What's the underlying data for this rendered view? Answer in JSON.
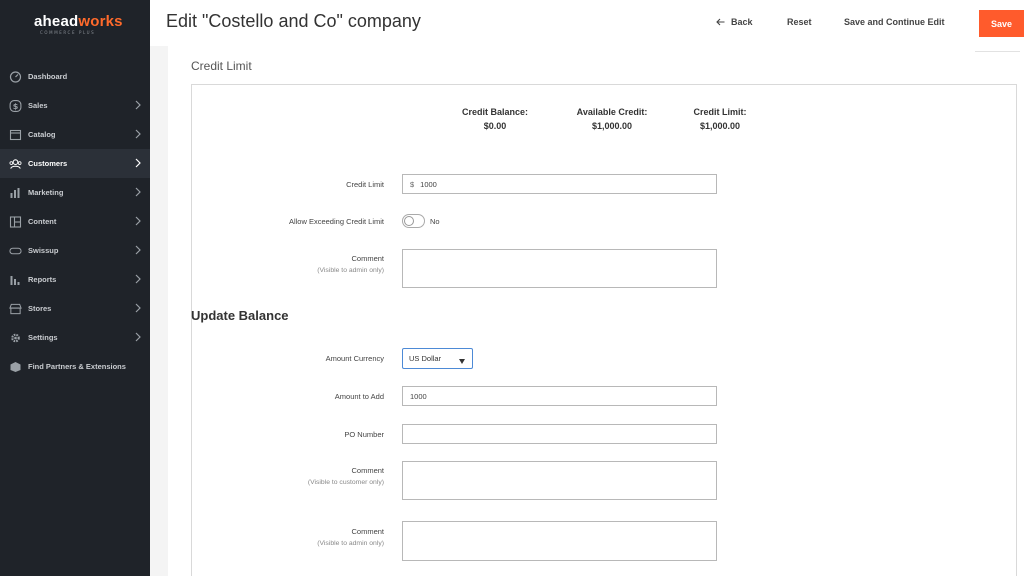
{
  "app": {
    "logo_part1": "ahead",
    "logo_part2": "works",
    "logo_tagline": "COMMERCE PLUS"
  },
  "sidebar": {
    "items": [
      {
        "label": "Dashboard",
        "icon": "dashboard-icon",
        "chevron": false
      },
      {
        "label": "Sales",
        "icon": "dollar-icon",
        "chevron": true
      },
      {
        "label": "Catalog",
        "icon": "catalog-box-icon",
        "chevron": true
      },
      {
        "label": "Customers",
        "icon": "customers-icon",
        "chevron": true,
        "active": true
      },
      {
        "label": "Marketing",
        "icon": "marketing-chart-icon",
        "chevron": true
      },
      {
        "label": "Content",
        "icon": "content-layout-icon",
        "chevron": true
      },
      {
        "label": "Swissup",
        "icon": "swissup-icon",
        "chevron": true
      },
      {
        "label": "Reports",
        "icon": "reports-bar-icon",
        "chevron": true
      },
      {
        "label": "Stores",
        "icon": "stores-icon",
        "chevron": true
      },
      {
        "label": "Settings",
        "icon": "gear-icon",
        "chevron": true
      },
      {
        "label": "Find Partners & Extensions",
        "icon": "partners-box-icon",
        "chevron": false
      }
    ]
  },
  "header": {
    "title": "Edit \"Costello and Co\" company",
    "back_label": "Back",
    "reset_label": "Reset",
    "save_continue_label": "Save and Continue Edit",
    "save_label": "Save"
  },
  "credit": {
    "section_title": "Credit Limit",
    "balance_label": "Credit Balance:",
    "balance_value": "$0.00",
    "available_label": "Available Credit:",
    "available_value": "$1,000.00",
    "limit_label": "Credit Limit:",
    "limit_value": "$1,000.00",
    "credit_limit_field_label": "Credit Limit",
    "currency_symbol": "$",
    "credit_limit_value": "1000",
    "allow_exceeding_label": "Allow Exceeding Credit Limit",
    "allow_exceeding_value": "No",
    "comment_label": "Comment",
    "comment_note": "(Visible to admin only)"
  },
  "update_balance": {
    "title": "Update Balance",
    "currency_label": "Amount Currency",
    "currency_value": "US Dollar",
    "amount_label": "Amount to Add",
    "amount_value": "1000",
    "po_label": "PO Number",
    "po_value": "",
    "comment_customer_label": "Comment",
    "comment_customer_note": "(Visible to customer only)",
    "comment_admin_label": "Comment",
    "comment_admin_note": "(Visible to admin only)"
  },
  "colors": {
    "sidebar_bg": "#1f2329",
    "accent": "#ff5b2c",
    "logo_accent": "#ff6a2b"
  }
}
